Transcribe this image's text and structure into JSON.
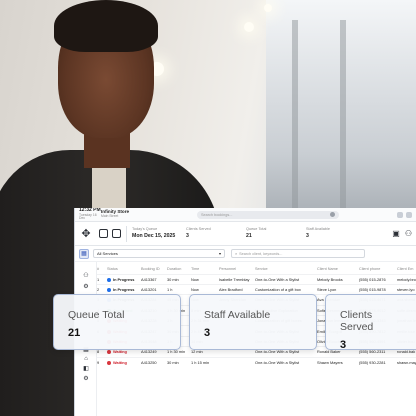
{
  "topbar": {
    "time": "12:32 PM",
    "date": "Tuesday 16 Dec",
    "store_name": "Infinity Store",
    "store_sub": "Main Street",
    "search_placeholder": "Search bookings..."
  },
  "stats": [
    {
      "label": "Today's Queue",
      "value": "Mon Dec 15, 2025"
    },
    {
      "label": "Clients Served",
      "value": "3"
    },
    {
      "label": "Queue Total",
      "value": "21"
    },
    {
      "label": "Staff Available",
      "value": "3"
    }
  ],
  "filter": {
    "service_select": "All Services",
    "search_placeholder": "Search client, keywords..."
  },
  "table": {
    "headers": [
      "#",
      "Status",
      "Booking ID",
      "Duration",
      "Time",
      "Personnel",
      "Service",
      "Client Name",
      "Client phone",
      "Client Em"
    ],
    "rows": [
      [
        "1",
        "In Progress",
        "A413367",
        "30 min",
        "Now",
        "Isabelle Tremblay",
        "One-to-One With a Stylist",
        "Melody Brooks",
        "(555) 015-2876",
        "melody.bro"
      ],
      [
        "2",
        "In Progress",
        "A413201",
        "1 h",
        "Now",
        "Alex Bradford",
        "Customization of a gift box",
        "Steve Lyon",
        "(555) 015-9878",
        "steven.lyo"
      ],
      [
        "3",
        "In Progress",
        "A413284",
        "45 min",
        "Now",
        "Jenny Sheridan",
        "One-to-One With a Stylist",
        "Ava Sheridan",
        "(555) 015-4471",
        "ava.sherid"
      ],
      [
        "4",
        "Confirmed",
        "A413210",
        "1 h 30 min",
        "8 min",
        "",
        "Merchandise Exploration",
        "Sofie Desmeures",
        "(555) 674-9012",
        "sofie.desm"
      ],
      [
        "5",
        "Waiting",
        "A413228",
        "1 h",
        "2 h 31 min",
        "",
        "Customization of gift boxes",
        "Jonathan lemagne",
        "(555) 782-3345",
        "jonathan.le"
      ],
      [
        "6",
        "Waiting",
        "A413247",
        "30 min",
        "2 h 47 min",
        "",
        "One-to-One With a Stylist",
        "Emilie Tourgoli",
        "(555) 890-7812",
        "emilie.tour"
      ],
      [
        "7",
        "Waiting",
        "A413048",
        "1 h",
        "14 min",
        "",
        "One-to-One With a Stylist",
        "Olivier Bouchard",
        "(555) 560-4591",
        "olivier.bou"
      ],
      [
        "8",
        "Waiting",
        "A413249",
        "1 h 30 min",
        "12 min",
        "",
        "One-to-One With a Stylist",
        "Ronald Baker",
        "(555) 560-2311",
        "ronald.bak"
      ],
      [
        "9",
        "Waiting",
        "A413250",
        "30 min",
        "1 h 15 min",
        "",
        "One-to-One With a Stylist",
        "Shawn Mayers",
        "(555) 930-2281",
        "shawn.may"
      ]
    ]
  },
  "cards": [
    {
      "label": "Queue Total",
      "value": "21"
    },
    {
      "label": "Staff Available",
      "value": "3"
    },
    {
      "label": "Clients Served",
      "value": "3"
    }
  ],
  "colors": {
    "in_progress": "#1f6feb",
    "confirmed": "#27a148",
    "waiting": "#d9363e",
    "card_border": "#a9b9d6"
  }
}
